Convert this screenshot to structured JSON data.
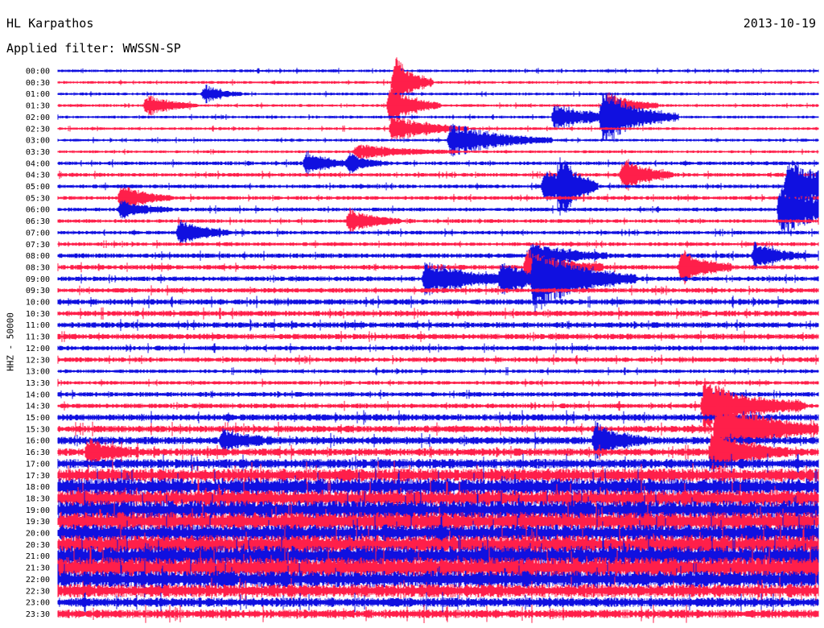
{
  "header": {
    "station": "HL Karpathos",
    "date": "2013-10-19",
    "filter": "Applied filter: WWSSN-SP",
    "channel_label": "HHZ - 50000"
  },
  "colors": {
    "trace_a": "#1010e0",
    "trace_b": "#ff1f4a",
    "background": "#ffffff"
  },
  "chart_data": {
    "type": "line",
    "title": "HL Karpathos",
    "subtitle": "Applied filter: WWSSN-SP",
    "date": "2013-10-19",
    "ylabel": "HHZ - 50000",
    "xlabel": "",
    "time_labels": [
      "00:00",
      "00:30",
      "01:00",
      "01:30",
      "02:00",
      "02:30",
      "03:00",
      "03:30",
      "04:00",
      "04:30",
      "05:00",
      "05:30",
      "06:00",
      "06:30",
      "07:00",
      "07:30",
      "08:00",
      "08:30",
      "09:00",
      "09:30",
      "10:00",
      "10:30",
      "11:00",
      "11:30",
      "12:00",
      "12:30",
      "13:00",
      "13:30",
      "14:00",
      "14:30",
      "15:00",
      "15:30",
      "16:00",
      "16:30",
      "17:00",
      "17:30",
      "18:00",
      "18:30",
      "19:00",
      "19:30",
      "20:00",
      "20:30",
      "21:00",
      "21:30",
      "22:00",
      "22:30",
      "23:00",
      "23:30"
    ],
    "trace_colors_alternate": [
      "blue",
      "red"
    ],
    "row_minutes": 30,
    "noise_level_by_row": [
      0.15,
      0.15,
      0.15,
      0.15,
      0.15,
      0.15,
      0.15,
      0.15,
      0.2,
      0.2,
      0.2,
      0.2,
      0.2,
      0.2,
      0.2,
      0.2,
      0.25,
      0.25,
      0.25,
      0.25,
      0.3,
      0.3,
      0.3,
      0.3,
      0.25,
      0.25,
      0.2,
      0.2,
      0.25,
      0.25,
      0.35,
      0.35,
      0.4,
      0.4,
      0.5,
      0.7,
      0.9,
      0.9,
      1.0,
      1.0,
      0.9,
      1.0,
      1.1,
      1.1,
      0.9,
      0.7,
      0.5,
      0.45
    ],
    "events": [
      {
        "row": 3,
        "minute": 3.5,
        "amplitude": 1.2,
        "duration": 2
      },
      {
        "row": 2,
        "minute": 5.8,
        "amplitude": 1.0,
        "duration": 1.5
      },
      {
        "row": 3,
        "minute": 13.1,
        "amplitude": 2.5,
        "duration": 2
      },
      {
        "row": 1,
        "minute": 13.3,
        "amplitude": 3.0,
        "duration": 1.5
      },
      {
        "row": 6,
        "minute": 15.5,
        "amplitude": 2.0,
        "duration": 4
      },
      {
        "row": 5,
        "minute": 13.2,
        "amplitude": 1.5,
        "duration": 3
      },
      {
        "row": 8,
        "minute": 9.8,
        "amplitude": 1.2,
        "duration": 2
      },
      {
        "row": 8,
        "minute": 11.5,
        "amplitude": 1.0,
        "duration": 1.5
      },
      {
        "row": 7,
        "minute": 11.8,
        "amplitude": 0.8,
        "duration": 4
      },
      {
        "row": 4,
        "minute": 21.5,
        "amplitude": 3.0,
        "duration": 3
      },
      {
        "row": 4,
        "minute": 19.6,
        "amplitude": 1.5,
        "duration": 3
      },
      {
        "row": 3,
        "minute": 21.7,
        "amplitude": 1.5,
        "duration": 2
      },
      {
        "row": 9,
        "minute": 22.3,
        "amplitude": 2.0,
        "duration": 2
      },
      {
        "row": 10,
        "minute": 19.8,
        "amplitude": 3.0,
        "duration": 1.5
      },
      {
        "row": 10,
        "minute": 19.2,
        "amplitude": 2.0,
        "duration": 2
      },
      {
        "row": 11,
        "minute": 2.5,
        "amplitude": 1.5,
        "duration": 2
      },
      {
        "row": 12,
        "minute": 2.5,
        "amplitude": 1.0,
        "duration": 2
      },
      {
        "row": 14,
        "minute": 4.8,
        "amplitude": 1.5,
        "duration": 2
      },
      {
        "row": 13,
        "minute": 11.5,
        "amplitude": 1.5,
        "duration": 2
      },
      {
        "row": 18,
        "minute": 14.5,
        "amplitude": 2.0,
        "duration": 4
      },
      {
        "row": 18,
        "minute": 17.5,
        "amplitude": 1.5,
        "duration": 3
      },
      {
        "row": 17,
        "minute": 18.5,
        "amplitude": 2.0,
        "duration": 3
      },
      {
        "row": 18,
        "minute": 18.8,
        "amplitude": 3.5,
        "duration": 4
      },
      {
        "row": 16,
        "minute": 18.7,
        "amplitude": 1.5,
        "duration": 3
      },
      {
        "row": 17,
        "minute": 24.6,
        "amplitude": 2.0,
        "duration": 2
      },
      {
        "row": 10,
        "minute": 28.8,
        "amplitude": 3.0,
        "duration": 4
      },
      {
        "row": 12,
        "minute": 28.5,
        "amplitude": 3.0,
        "duration": 4
      },
      {
        "row": 16,
        "minute": 27.5,
        "amplitude": 1.5,
        "duration": 2
      },
      {
        "row": 29,
        "minute": 25.5,
        "amplitude": 3.0,
        "duration": 4
      },
      {
        "row": 31,
        "minute": 26.0,
        "amplitude": 3.5,
        "duration": 4
      },
      {
        "row": 33,
        "minute": 25.8,
        "amplitude": 2.5,
        "duration": 3
      },
      {
        "row": 32,
        "minute": 21.2,
        "amplitude": 2.0,
        "duration": 2
      },
      {
        "row": 32,
        "minute": 6.5,
        "amplitude": 1.2,
        "duration": 2
      },
      {
        "row": 33,
        "minute": 1.2,
        "amplitude": 1.5,
        "duration": 2
      }
    ]
  }
}
